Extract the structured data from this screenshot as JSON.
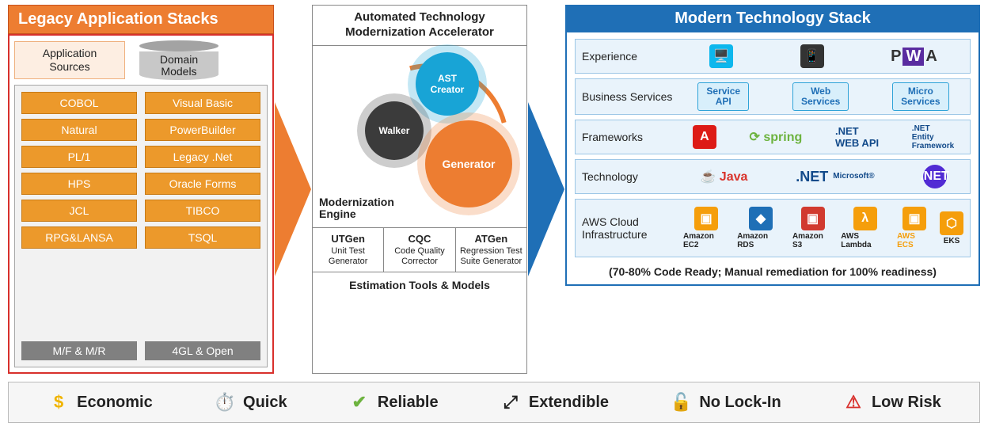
{
  "legacy": {
    "title": "Legacy Application Stacks",
    "appSourcesLabel": "Application\nSources",
    "domainModelsLabel": "Domain\nModels",
    "col1": [
      "COBOL",
      "Natural",
      "PL/1",
      "HPS",
      "JCL",
      "RPG&LANSA"
    ],
    "col2": [
      "Visual Basic",
      "PowerBuilder",
      "Legacy .Net",
      "Oracle Forms",
      "TIBCO",
      "TSQL"
    ],
    "foot1": "M/F & M/R",
    "foot2": "4GL & Open"
  },
  "accelerator": {
    "title": "Automated Technology Modernization Accelerator",
    "engineLabel": "Modernization\nEngine",
    "gears": {
      "ast": "AST\nCreator",
      "walker": "Walker",
      "generator": "Generator"
    },
    "tools": [
      {
        "name": "UTGen",
        "desc": "Unit Test Generator"
      },
      {
        "name": "CQC",
        "desc": "Code Quality Corrector"
      },
      {
        "name": "ATGen",
        "desc": "Regression Test Suite Generator"
      }
    ],
    "estimation": "Estimation Tools & Models"
  },
  "modern": {
    "title": "Modern Technology Stack",
    "layers": {
      "experience": {
        "label": "Experience",
        "items": [
          "Responsive Web",
          "Mobile",
          "PWA"
        ]
      },
      "business": {
        "label": "Business Services",
        "pills": [
          "Service\nAPI",
          "Web\nServices",
          "Micro\nServices"
        ]
      },
      "frameworks": {
        "label": "Frameworks",
        "items": [
          "Angular",
          "Spring",
          "WEB API",
          "Entity Framework"
        ]
      },
      "technology": {
        "label": "Technology",
        "items": [
          "Java",
          "Microsoft .NET",
          ".NET Core"
        ]
      },
      "aws": {
        "label": "AWS Cloud Infrastructure",
        "items": [
          "Amazon EC2",
          "Amazon RDS",
          "Amazon S3",
          "AWS Lambda",
          "AWS ECS",
          "EKS"
        ]
      }
    },
    "note": "(70-80% Code Ready; Manual remediation for 100% readiness)"
  },
  "benefits": [
    "Economic",
    "Quick",
    "Reliable",
    "Extendible",
    "No Lock-In",
    "Low Risk"
  ],
  "colors": {
    "orange": "#ed7d31",
    "blue": "#1f6fb6"
  }
}
